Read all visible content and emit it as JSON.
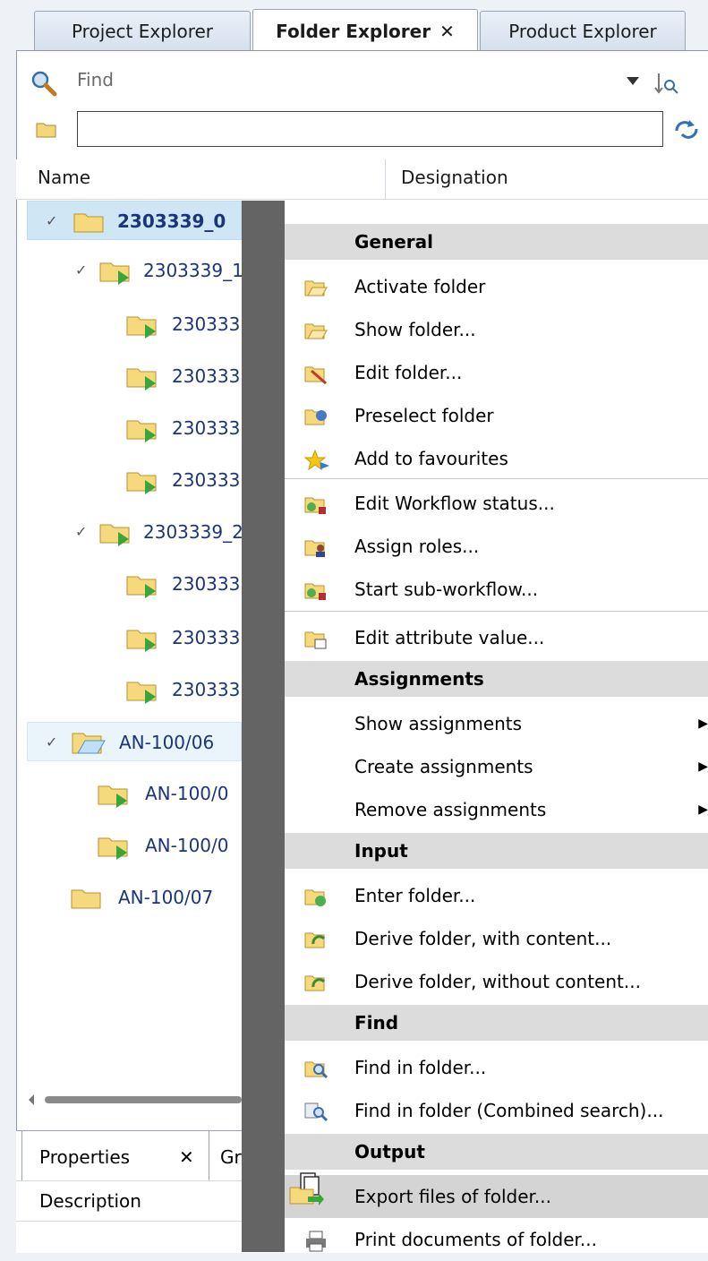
{
  "tabs": [
    {
      "label": "Project Explorer"
    },
    {
      "label": "Folder Explorer",
      "close": "✕"
    },
    {
      "label": "Product Explorer"
    }
  ],
  "findbar": {
    "label": "Find"
  },
  "path": {
    "value": ""
  },
  "columns": {
    "name": "Name",
    "designation": "Designation"
  },
  "tree": [
    {
      "label": "2303339_0"
    },
    {
      "label": "2303339_1"
    },
    {
      "label": "230333"
    },
    {
      "label": "230333"
    },
    {
      "label": "230333"
    },
    {
      "label": "230333"
    },
    {
      "label": "2303339_2"
    },
    {
      "label": "230333"
    },
    {
      "label": "230333"
    },
    {
      "label": "230333"
    },
    {
      "label": "AN-100/06"
    },
    {
      "label": "AN-100/0"
    },
    {
      "label": "AN-100/0"
    },
    {
      "label": "AN-100/07"
    }
  ],
  "bottom": {
    "tab_properties": "Properties",
    "tab_close": "✕",
    "tab_other": "Gr",
    "description_label": "Description"
  },
  "menu": {
    "sections": [
      {
        "header": "General"
      },
      {
        "header": "Assignments"
      },
      {
        "header": "Input"
      },
      {
        "header": "Find"
      },
      {
        "header": "Output"
      }
    ],
    "items": [
      {
        "label": "Activate folder"
      },
      {
        "label": "Show folder..."
      },
      {
        "label": "Edit folder..."
      },
      {
        "label": "Preselect folder"
      },
      {
        "label": "Add to favourites"
      },
      {
        "label": "Edit Workflow status..."
      },
      {
        "label": "Assign roles..."
      },
      {
        "label": "Start sub-workflow..."
      },
      {
        "label": "Edit attribute value..."
      },
      {
        "label": "Show assignments"
      },
      {
        "label": "Create assignments"
      },
      {
        "label": "Remove assignments"
      },
      {
        "label": "Enter folder..."
      },
      {
        "label": "Derive folder, with content..."
      },
      {
        "label": "Derive folder, without content..."
      },
      {
        "label": "Find in folder..."
      },
      {
        "label": "Find in folder (Combined search)..."
      },
      {
        "label": "Export files of folder..."
      },
      {
        "label": "Print documents of folder..."
      }
    ],
    "submenu_arrow": "▶"
  }
}
